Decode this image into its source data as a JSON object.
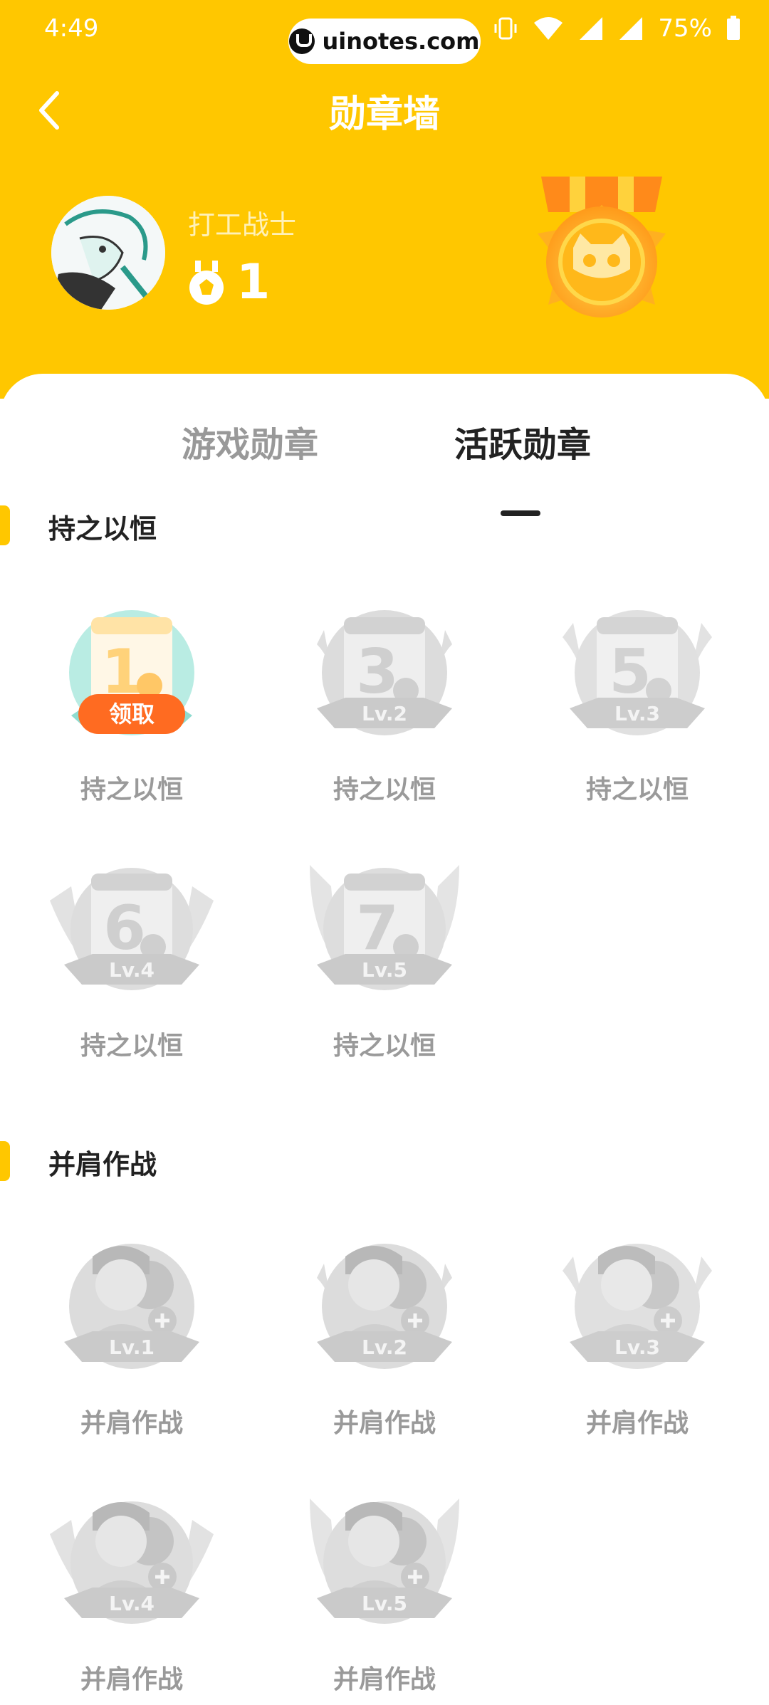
{
  "status_bar": {
    "time": "4:49",
    "battery": "75%",
    "watermark": "uinotes.com"
  },
  "header": {
    "title": "勋章墙",
    "back_icon": "chevron-left-icon"
  },
  "profile": {
    "username": "打工战士",
    "medal_count": "1"
  },
  "tabs": [
    {
      "label": "游戏勋章",
      "active": false
    },
    {
      "label": "活跃勋章",
      "active": true
    }
  ],
  "sections": [
    {
      "title": "持之以恒",
      "badges": [
        {
          "label": "持之以恒",
          "digit": "1",
          "level": "",
          "claim": "领取",
          "unlocked": true
        },
        {
          "label": "持之以恒",
          "digit": "3",
          "level": "Lv.2",
          "claim": "",
          "unlocked": false
        },
        {
          "label": "持之以恒",
          "digit": "5",
          "level": "Lv.3",
          "claim": "",
          "unlocked": false
        },
        {
          "label": "持之以恒",
          "digit": "6",
          "level": "Lv.4",
          "claim": "",
          "unlocked": false
        },
        {
          "label": "持之以恒",
          "digit": "7",
          "level": "Lv.5",
          "claim": "",
          "unlocked": false
        }
      ]
    },
    {
      "title": "并肩作战",
      "badges": [
        {
          "label": "并肩作战",
          "level": "Lv.1",
          "unlocked": false
        },
        {
          "label": "并肩作战",
          "level": "Lv.2",
          "unlocked": false
        },
        {
          "label": "并肩作战",
          "level": "Lv.3",
          "unlocked": false
        },
        {
          "label": "并肩作战",
          "level": "Lv.4",
          "unlocked": false
        },
        {
          "label": "并肩作战",
          "level": "Lv.5",
          "unlocked": false
        }
      ]
    }
  ],
  "colors": {
    "brand_yellow": "#ffc700",
    "claim_orange": "#ff6b21",
    "inactive_gray": "#cfcfcf"
  }
}
